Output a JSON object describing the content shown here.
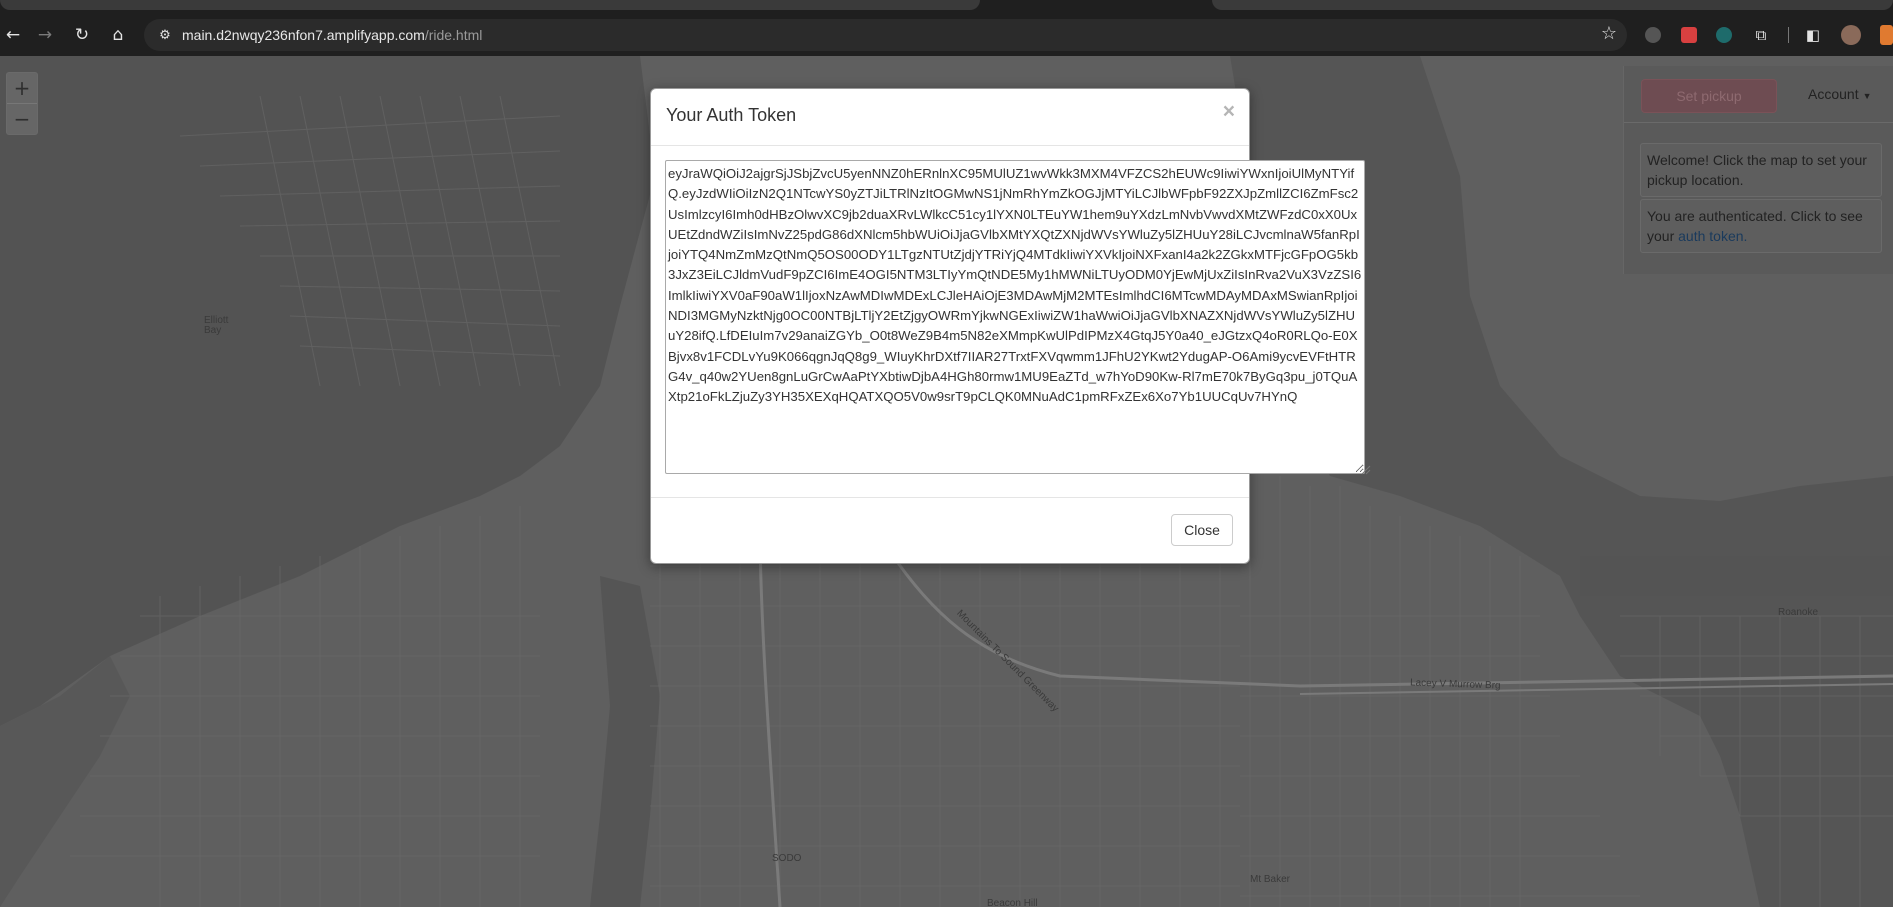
{
  "browser": {
    "url_host": "main.d2nwqy236nfon7.amplifyapp.com",
    "url_path": "/ride.html",
    "icons": {
      "back": "back-arrow-icon",
      "forward": "forward-arrow-icon",
      "reload": "reload-icon",
      "home": "home-icon",
      "site_info": "site-info-icon",
      "bookmark": "star-icon",
      "extensions": "puzzle-icon",
      "side_panel": "side-panel-icon",
      "profile": "profile-avatar-icon"
    }
  },
  "map": {
    "zoom_in": "+",
    "zoom_out": "−",
    "labels": {
      "elliott_bay": "Elliott\nBay",
      "sodo": "SODO",
      "mt_baker": "Mt Baker",
      "beacon_hill": "Beacon Hill",
      "roanoke": "Roanoke",
      "mountains_to_sound": "Mountains To Sound Greenway",
      "lacey_murrow": "Lacey V Murrow Brg"
    }
  },
  "panel": {
    "set_pickup": "Set pickup",
    "account": "Account",
    "welcome": "Welcome! Click the map to set your pickup location.",
    "auth_text_prefix": "You are authenticated. Click to see your",
    "auth_link": "auth token."
  },
  "modal": {
    "title": "Your Auth Token",
    "close_x": "×",
    "token": "eyJraWQiOiJ2ajgrSjJSbjZvcU5yenNNZ0hERnlnXC95MUlUZ1wvWkk3MXM4VFZCS2hEUWc9IiwiYWxnIjoiUlMyNTYifQ.eyJzdWIiOiIzN2Q1NTcwYS0yZTJiLTRlNzItOGMwNS1jNmRhYmZkOGJjMTYiLCJlbWFpbF92ZXJpZmllZCI6ZmFsc2UsImlzcyI6Imh0dHBzOlwvXC9jb2duaXRvLWlkcC51cy1lYXN0LTEuYW1hem9uYXdzLmNvbVwvdXMtZWFzdC0xX0UxUEtZdndWZiIsImNvZ25pdG86dXNlcm5hbWUiOiJjaGVlbXMtYXQtZXNjdWVsYWluZy5lZHUuY28iLCJvcmlnaW5fanRpIjoiYTQ4NmZmMzQtNmQ5OS00ODY1LTgzNTUtZjdjYTRiYjQ4MTdkIiwiYXVkIjoiNXFxanI4a2k2ZGkxMTFjcGFpOG5kb3JxZ3EiLCJldmVudF9pZCI6ImE4OGI5NTM3LTIyYmQtNDE5My1hMWNiLTUyODM0YjEwMjUxZiIsInRva2VuX3VzZSI6ImlkIiwiYXV0aF90aW1lIjoxNzAwMDIwMDExLCJleHAiOjE3MDAwMjM2MTEsImlhdCI6MTcwMDAyMDAxMSwianRpIjoiNDI3MGMyNzktNjg0OC00NTBjLTljY2EtZjgyOWRmYjkwNGExIiwiZW1haWwiOiJjaGVlbXNAZXNjdWVsYWluZy5lZHUuY28ifQ.LfDEIuIm7v29anaiZGYb_O0t8WeZ9B4m5N82eXMmpKwUlPdIPMzX4GtqJ5Y0a40_eJGtzxQ4oR0RLQo-E0XBjvx8v1FCDLvYu9K066qgnJqQ8g9_WIuyKhrDXtf7IIAR27TrxtFXVqwmm1JFhU2YKwt2YdugAP-O6Ami9ycvEVFtHTRG4v_q40w2YUen8gnLuGrCwAaPtYXbtiwDjbA4HGh80rmw1MU9EaZTd_w7hYoD90Kw-Rl7mE70k7ByGq3pu_j0TQuAXtp21oFkLZjuZy3YH35XEXqHQATXQO5V0w9srT9pCLQK0MNuAdC1pmRFxZEx6Xo7Yb1UUCqUv7HYnQ",
    "close_button": "Close"
  }
}
